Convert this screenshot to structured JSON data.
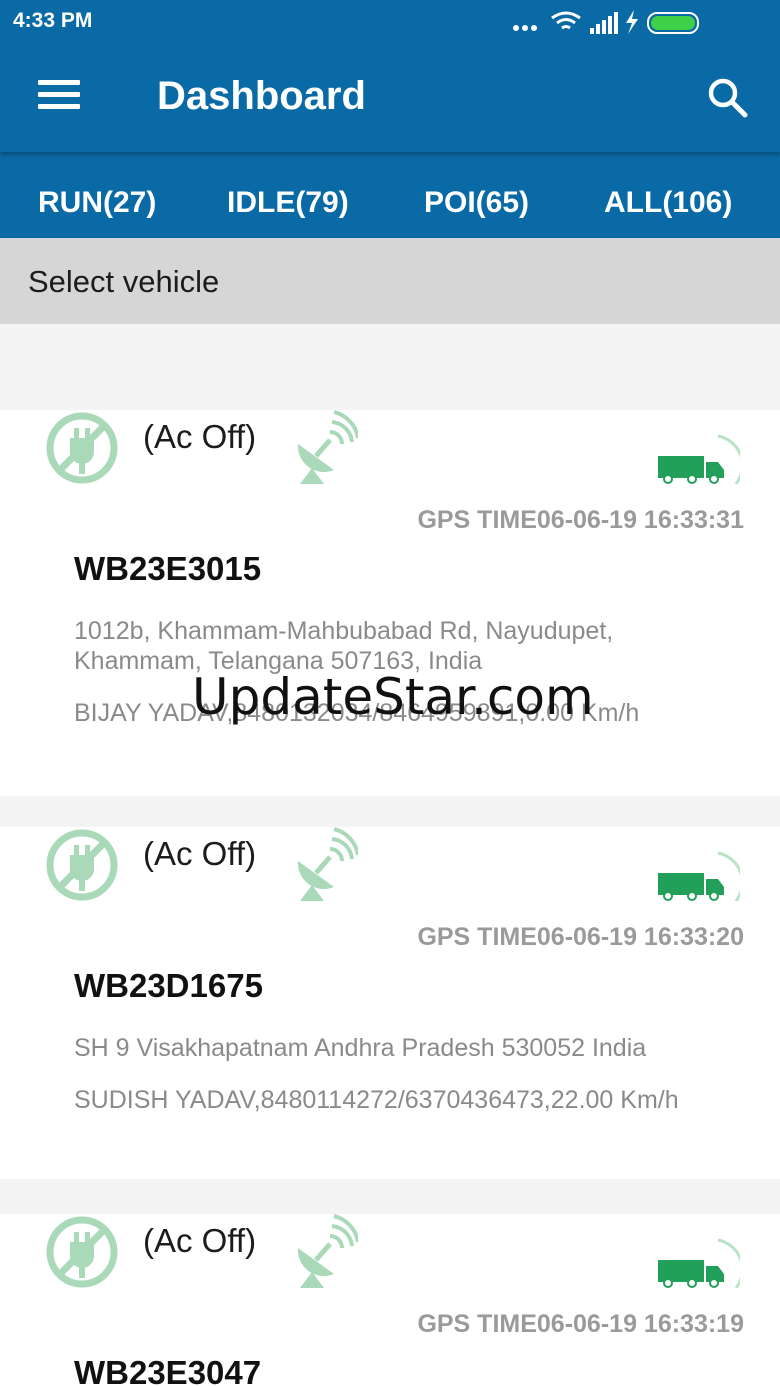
{
  "status_bar": {
    "time": "4:33 PM",
    "icons": [
      "more-dots-icon",
      "wifi-icon",
      "signal-icon",
      "charging-icon",
      "battery-icon"
    ]
  },
  "app_bar": {
    "title": "Dashboard",
    "menu_icon": "hamburger-menu-icon",
    "search_icon": "search-icon",
    "color": "#0a6aa6"
  },
  "tabs": [
    {
      "label": "RUN(27)"
    },
    {
      "label": "IDLE(79)"
    },
    {
      "label": "POI(65)"
    },
    {
      "label": "ALL(106)"
    }
  ],
  "select_vehicle": {
    "label": "Select vehicle"
  },
  "vehicles": [
    {
      "ac_status": "(Ac Off)",
      "gps_time": "GPS TIME06-06-19 16:33:31",
      "vehicle_no": "WB23E3015",
      "address": "1012b, Khammam-Mahbubabad Rd, Nayudupet, Khammam, Telangana 507163, India",
      "driver_info": "BIJAY YADAV,8480132034/8464959891,0.00 Km/h"
    },
    {
      "ac_status": "(Ac Off)",
      "gps_time": "GPS TIME06-06-19 16:33:20",
      "vehicle_no": "WB23D1675",
      "address": "SH 9  Visakhapatnam  Andhra Pradesh 530052  India",
      "driver_info": "SUDISH YADAV,8480114272/6370436473,22.00 Km/h"
    },
    {
      "ac_status": "(Ac Off)",
      "gps_time": "GPS TIME06-06-19 16:33:19",
      "vehicle_no": "WB23E3047"
    }
  ],
  "icon_color": "#2fa55a",
  "watermark": "UpdateStar.com"
}
